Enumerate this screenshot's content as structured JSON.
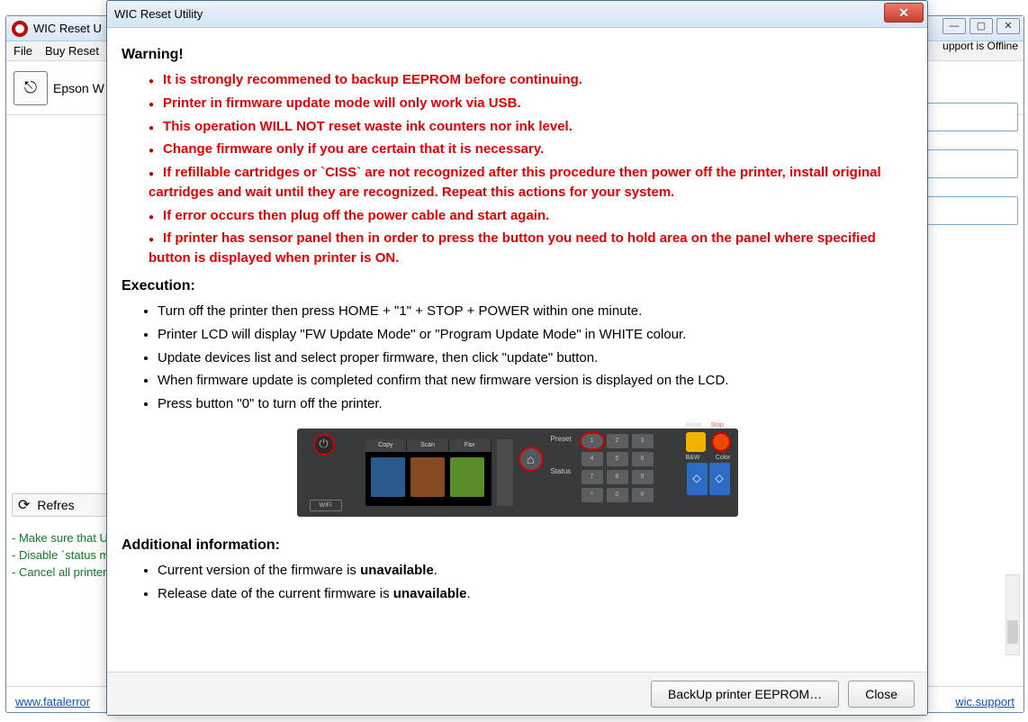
{
  "bg": {
    "title": "WIC Reset U",
    "win_min": "—",
    "win_max": "▢",
    "win_close": "✕",
    "menu": {
      "file": "File",
      "buy": "Buy Reset"
    },
    "printer": "Epson W",
    "support": "upport is Offline",
    "refresh": "Refres",
    "hints": {
      "h1": "- Make sure that U",
      "h2": "- Disable `status m",
      "h3": "- Cancel all printer"
    },
    "link_left": "www.fatalerror",
    "link_right": "wic.support"
  },
  "dialog": {
    "title": "WIC Reset Utility",
    "warning_heading": "Warning!",
    "warnings": [
      "It is strongly recommened to backup EEPROM before continuing.",
      "Printer in firmware update mode will only work via USB.",
      "This operation WILL NOT reset waste ink counters nor ink level.",
      "Change firmware only if you are certain that it is necessary.",
      "If refillable cartridges or `CISS` are not recognized after this procedure then power off the printer, install original cartridges and wait until they are recognized. Repeat this actions for your system.",
      "If error occurs then plug off the power cable and start again.",
      "If printer has sensor panel then in order to press the button you need to hold area on the panel where specified button is displayed when printer is ON."
    ],
    "exec_heading": "Execution:",
    "exec": [
      "Turn off the printer then press HOME + \"1\" + STOP + POWER within one minute.",
      "Printer LCD will display \"FW Update Mode\" or \"Program Update Mode\" in WHITE colour.",
      "Update devices list and select proper firmware, then click \"update\" button.",
      "When firmware update is completed confirm that new firmware version is displayed on the LCD.",
      "Press button \"0\" to turn off the printer."
    ],
    "addinfo_heading": "Additional information:",
    "addinfo": {
      "a1_pre": "Current version of the firmware is ",
      "a1_val": "unavailable",
      "a2_pre": "Release date of the current firmware is ",
      "a2_val": "unavailable"
    },
    "panel": {
      "power": "⏻",
      "wifi": "WiFi",
      "tabs": {
        "copy": "Copy",
        "scan": "Scan",
        "fax": "Fax"
      },
      "home": "⌂",
      "preset": "Preset",
      "status": "Status",
      "keys": {
        "k1": "1",
        "k2": "2",
        "k3": "3",
        "k4": "4",
        "k5": "5",
        "k6": "6",
        "k7": "7",
        "k8": "8",
        "k9": "9",
        "kst": "*",
        "k0": "0",
        "kha": "#"
      },
      "reset_lbl": "Reset",
      "stop_lbl": "Stop",
      "start_lbl_l": "B&W",
      "start_lbl_r": "Color",
      "diamond": "◇"
    },
    "btn_backup": "BackUp printer EEPROM…",
    "btn_close": "Close"
  }
}
